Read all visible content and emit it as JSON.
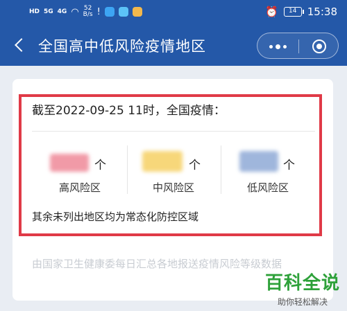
{
  "status_bar": {
    "hd": "HD",
    "sig1": "5G",
    "sig2": "4G",
    "speed_value": "52",
    "speed_unit": "B/s",
    "battery": "14",
    "time": "15:38"
  },
  "header": {
    "title": "全国高中低风险疫情地区",
    "back_icon": "chevron-left-icon",
    "more_icon": "more-dots-icon",
    "close_icon": "target-close-icon"
  },
  "colors": {
    "header_bg": "#2458a8",
    "highlight_border": "#e03a47",
    "high_blur": "#f19aa7",
    "mid_blur": "#f7d77a",
    "low_blur": "#9fb6dc",
    "watermark": "#2ea13a"
  },
  "stats": {
    "as_of": "截至2022-09-25 11时，全国疫情：",
    "arrow": "个",
    "high_label": "高风险区",
    "mid_label": "中风险区",
    "low_label": "低风险区",
    "note": "其余未列出地区均为常态化防控区域"
  },
  "source": "由国家卫生健康委每日汇总各地报送疫情风险等级数据",
  "watermark": {
    "main": "百科全说",
    "sub": "助你轻松解决"
  }
}
